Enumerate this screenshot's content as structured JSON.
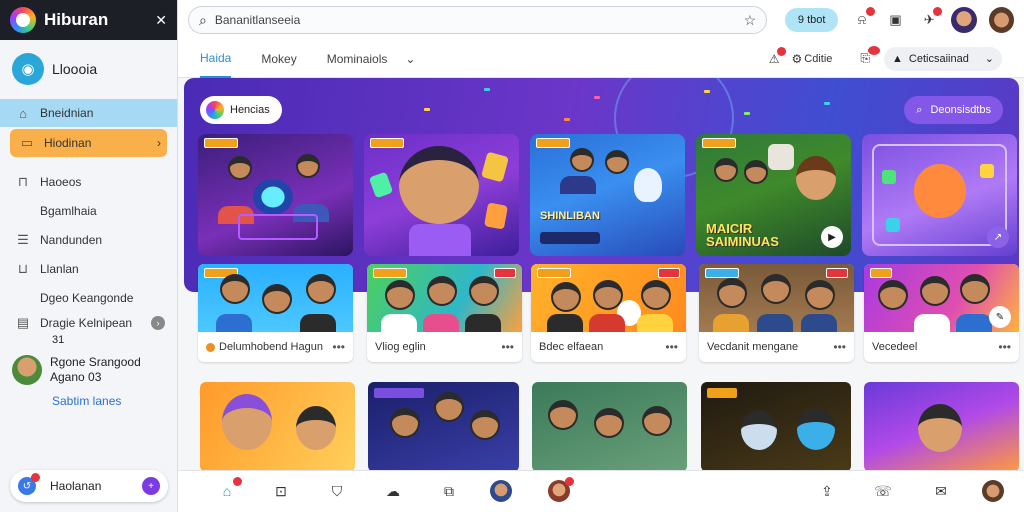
{
  "window": {
    "title": "Hiburan"
  },
  "sidebar": {
    "profile_name": "Lloooia",
    "items": [
      {
        "label": "Bneidnian",
        "icon": "home-icon"
      },
      {
        "label": "Hiodinan",
        "icon": "folder-icon",
        "arrow": "›"
      },
      {
        "label": "Haoeos",
        "icon": "inbox-icon"
      },
      {
        "label": "Bgamlhaia",
        "icon": ""
      },
      {
        "label": "Nandunden",
        "icon": "list-icon"
      },
      {
        "label": "Llanlan",
        "icon": "tray-icon"
      },
      {
        "label": "Dgeo Keangonde",
        "icon": ""
      },
      {
        "label": "Dragie Kelnipean",
        "icon": "doc-icon",
        "sub": "31"
      }
    ],
    "user": {
      "name": "Rgone Srangood",
      "sub": "Agano 03"
    },
    "link": "Sabtim lanes",
    "bottom_label": "Haolanan"
  },
  "topbar": {
    "search_value": "Bananitlanseeia",
    "pill_label": "9 tbot"
  },
  "tabs": {
    "items": [
      "Haida",
      "Mokey",
      "Mominaiols"
    ],
    "chevron": "⌄",
    "right_label": "Cditie",
    "sort_label": "Ceticsaiinad"
  },
  "hero": {
    "chip_label": "Hencias",
    "button_label": "Deonsisdtbs"
  },
  "tiles": [
    {
      "text": ""
    },
    {
      "text": ""
    },
    {
      "text": "SHINLIBAN"
    },
    {
      "text": "MAICIR SAIMINUAS"
    },
    {
      "text": ""
    }
  ],
  "cards_row2": [
    {
      "title": "Delumhobend Hagun"
    },
    {
      "title": "Vliog eglin"
    },
    {
      "title": "Bdec elfaean"
    },
    {
      "title": "Vecdanit mengane"
    },
    {
      "title": "Vecedeel"
    }
  ],
  "more_glyph": "•••",
  "colors": {
    "accent": "#2b8fd6",
    "hero": "#5b38c5",
    "highlight": "#f9b04a",
    "badge": "#e5343d"
  }
}
